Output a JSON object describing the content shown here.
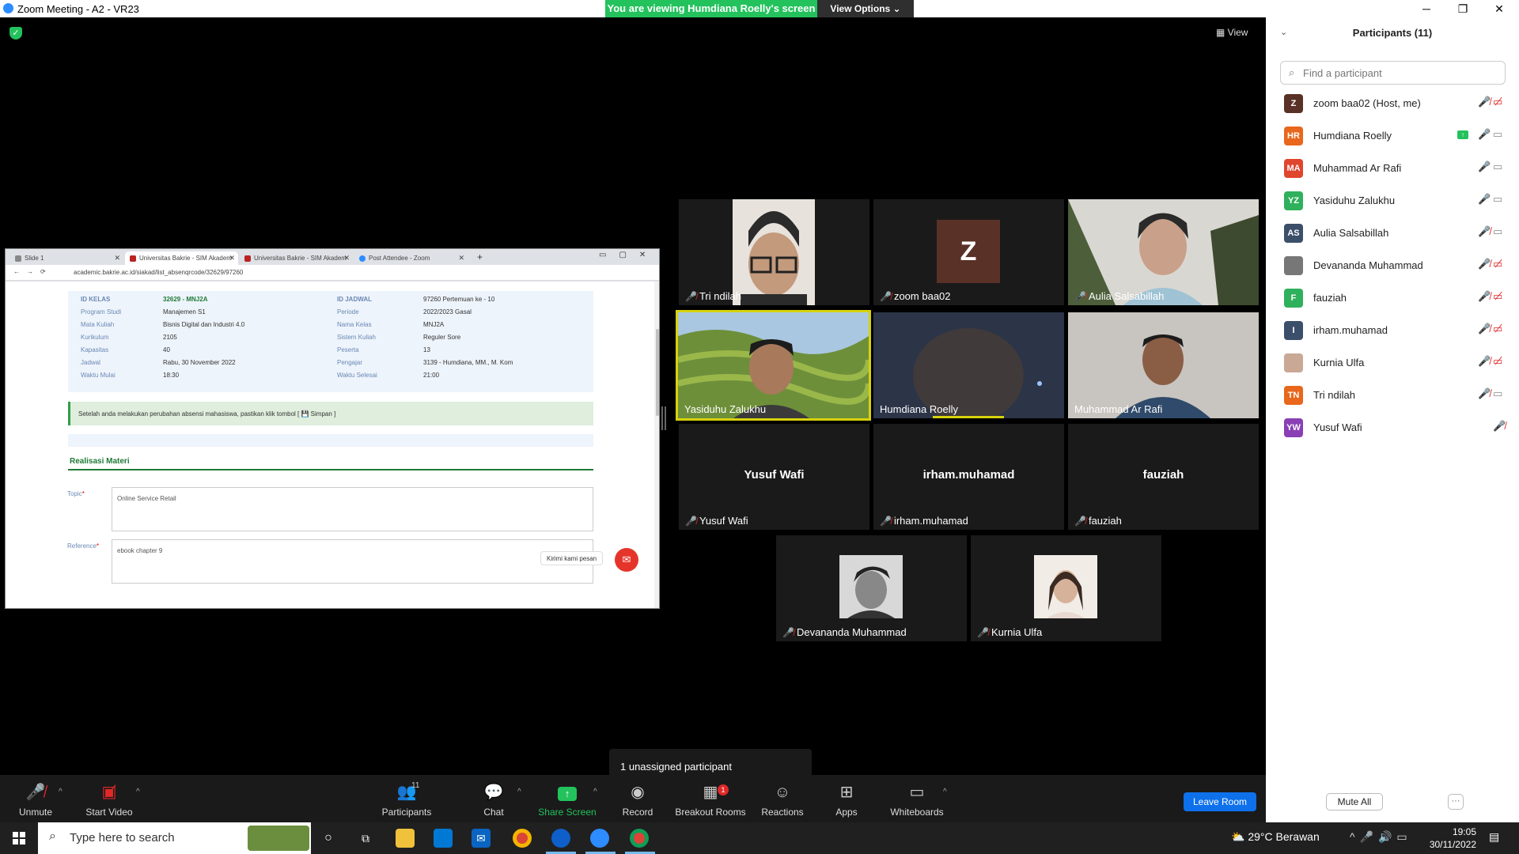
{
  "window": {
    "title": "Zoom Meeting - A2 - VR23",
    "viewing_banner": "You are viewing Humdiana Roelly's screen",
    "view_options": "View Options ⌄",
    "minimize": "─",
    "maximize": "❐",
    "close": "✕"
  },
  "meeting": {
    "view_label": "View"
  },
  "shared_screen": {
    "tabs": [
      "Slide 1",
      "Universitas Bakrie - SIM Akadem",
      "Universitas Bakrie - SIM Akadem",
      "Post Attendee - Zoom"
    ],
    "new_tab": "+",
    "url": "academic.bakrie.ac.id/siakad/list_absenqrcode/32629/97260",
    "info": {
      "id_kelas_label": "ID KELAS",
      "id_kelas": "32629 - MNJ2A",
      "prodi_label": "Program Studi",
      "prodi": "Manajemen S1",
      "matkul_label": "Mata Kuliah",
      "matkul": "Bisnis Digital dan Industri 4.0",
      "kurikulum_label": "Kurikulum",
      "kurikulum": "2105",
      "kapasitas_label": "Kapasitas",
      "kapasitas": "40",
      "jadwal_label": "Jadwal",
      "jadwal": "Rabu, 30 November 2022",
      "mulai_label": "Waktu Mulai",
      "mulai": "18:30",
      "id_jadwal_label": "ID JADWAL",
      "id_jadwal": "97260 Pertemuan ke - 10",
      "periode_label": "Periode",
      "periode": "2022/2023 Gasal",
      "nama_kelas_label": "Nama Kelas",
      "nama_kelas": "MNJ2A",
      "sistem_label": "Sistem Kuliah",
      "sistem": "Reguler Sore",
      "peserta_label": "Peserta",
      "peserta": "13",
      "pengajar_label": "Pengajar",
      "pengajar": "3139 - Humdiana, MM., M. Kom",
      "selesai_label": "Waktu Selesai",
      "selesai": "21:00"
    },
    "notice": "Setelah anda melakukan perubahan absensi mahasiswa, pastikan klik tombol [ 💾 Simpan ]",
    "section_title": "Realisasi Materi",
    "topic_label": "Topic",
    "topic_value": "Online Service Retail",
    "reference_label": "Reference",
    "reference_value": "ebook chapter 9",
    "required_mark": "*",
    "kirimi": "Kirimi kami pesan"
  },
  "tiles": [
    {
      "name": "Tri ndilah",
      "muted": true
    },
    {
      "name": "zoom baa02",
      "muted": true,
      "avatar_letter": "Z"
    },
    {
      "name": "Aulia Salsabillah",
      "muted": true
    },
    {
      "name": "Yasiduhu Zalukhu",
      "muted": false
    },
    {
      "name": "Humdiana Roelly",
      "muted": false
    },
    {
      "name": "Muhammad Ar Rafi",
      "muted": false
    },
    {
      "name": "Yusuf Wafi",
      "muted": true
    },
    {
      "name": "irham.muhamad",
      "muted": true
    },
    {
      "name": "fauziah",
      "muted": true
    },
    {
      "name": "Devananda Muhammad",
      "muted": true
    },
    {
      "name": "Kurnia Ulfa",
      "muted": true
    }
  ],
  "toolbar": {
    "unmute": "Unmute",
    "start_video": "Start Video",
    "participants": "Participants",
    "participants_count": "11",
    "chat": "Chat",
    "share_screen": "Share Screen",
    "record": "Record",
    "breakout_rooms": "Breakout Rooms",
    "breakout_badge": "1",
    "reactions": "Reactions",
    "apps": "Apps",
    "whiteboards": "Whiteboards",
    "leave_room": "Leave Room",
    "caret": "^"
  },
  "toast": "1 unassigned participant",
  "panel": {
    "title": "Participants (11)",
    "search_placeholder": "Find a participant",
    "mute_all": "Mute All",
    "more": "···",
    "participants": [
      {
        "initials": "Z",
        "name": "zoom baa02 (Host, me)",
        "color": "#5a3126"
      },
      {
        "initials": "HR",
        "name": "Humdiana Roelly",
        "color": "#e8671c"
      },
      {
        "initials": "MA",
        "name": "Muhammad Ar Rafi",
        "color": "#e0452d"
      },
      {
        "initials": "YZ",
        "name": "Yasiduhu Zalukhu",
        "color": "#2fb05c"
      },
      {
        "initials": "AS",
        "name": "Aulia Salsabillah",
        "color": "#3c4f6a"
      },
      {
        "initials": "",
        "name": "Devananda Muhammad",
        "color": "#555555"
      },
      {
        "initials": "F",
        "name": "fauziah",
        "color": "#2fb05c"
      },
      {
        "initials": "I",
        "name": "irham.muhamad",
        "color": "#3c4f6a"
      },
      {
        "initials": "",
        "name": "Kurnia Ulfa",
        "color": "#9a7b6a"
      },
      {
        "initials": "TN",
        "name": "Tri ndilah",
        "color": "#e8671c"
      },
      {
        "initials": "YW",
        "name": "Yusuf Wafi",
        "color": "#8a3fb5"
      }
    ]
  },
  "taskbar": {
    "search_placeholder": "Type here to search",
    "weather": "29°C  Berawan",
    "time": "19:05",
    "date": "30/11/2022"
  }
}
